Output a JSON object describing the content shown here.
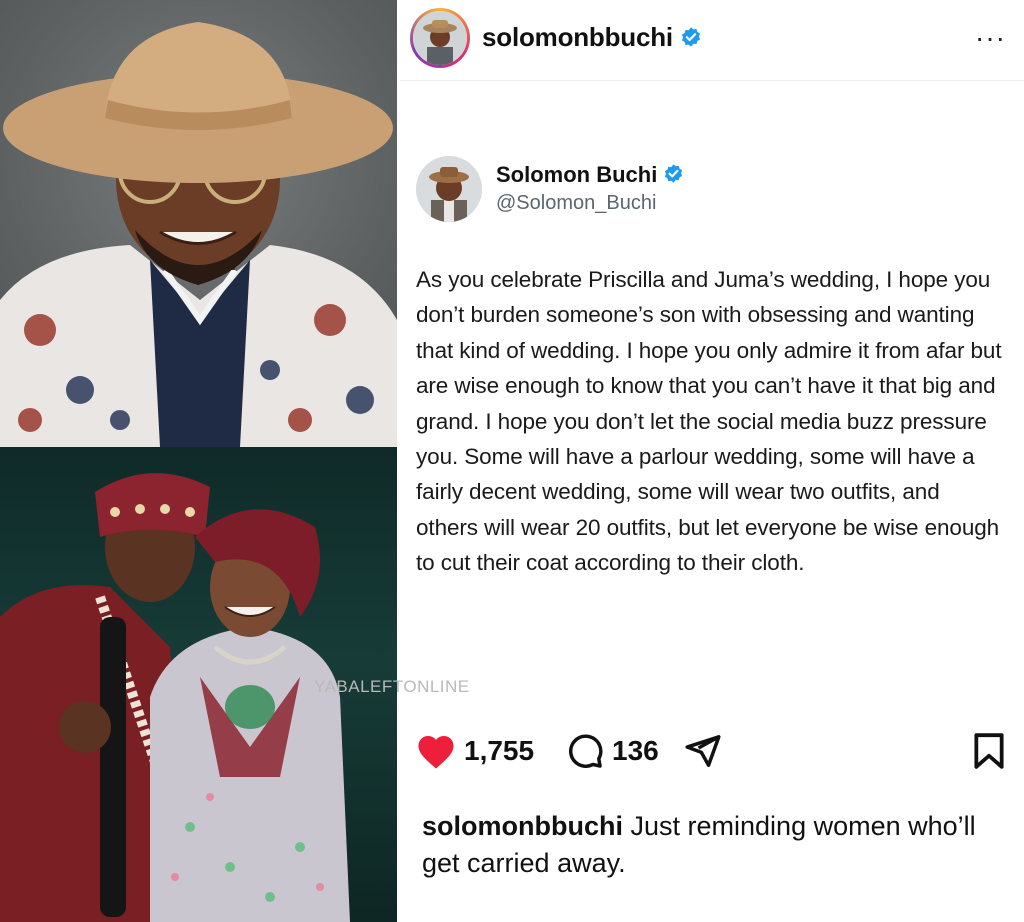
{
  "post": {
    "username": "solomonbbuchi",
    "more_label": "···",
    "likes": "1,755",
    "comments": "136",
    "caption_text": "Just reminding women who’ll get carried away."
  },
  "tweet": {
    "name": "Solomon Buchi",
    "handle": "@Solomon_Buchi",
    "text": "As you celebrate Priscilla and Juma’s wedding, I hope you don’t burden someone’s son with obsessing and wanting that kind of wedding. I hope you only admire it from afar but are wise enough to know that you can’t have it that big and grand. I hope you don’t let the social media buzz pressure you. Some will have a parlour wedding, some will have a fairly decent wedding, some will wear two outfits, and others will wear 20 outfits, but let everyone be wise enough to cut their coat according to their cloth."
  },
  "watermark": "YABALEFTONLINE",
  "colors": {
    "verified": "#1d9bf0",
    "heart": "#ed1f3a",
    "text": "#111111"
  },
  "icons": [
    "verified-icon",
    "more-icon",
    "heart-icon",
    "comment-icon",
    "share-icon",
    "bookmark-icon"
  ]
}
